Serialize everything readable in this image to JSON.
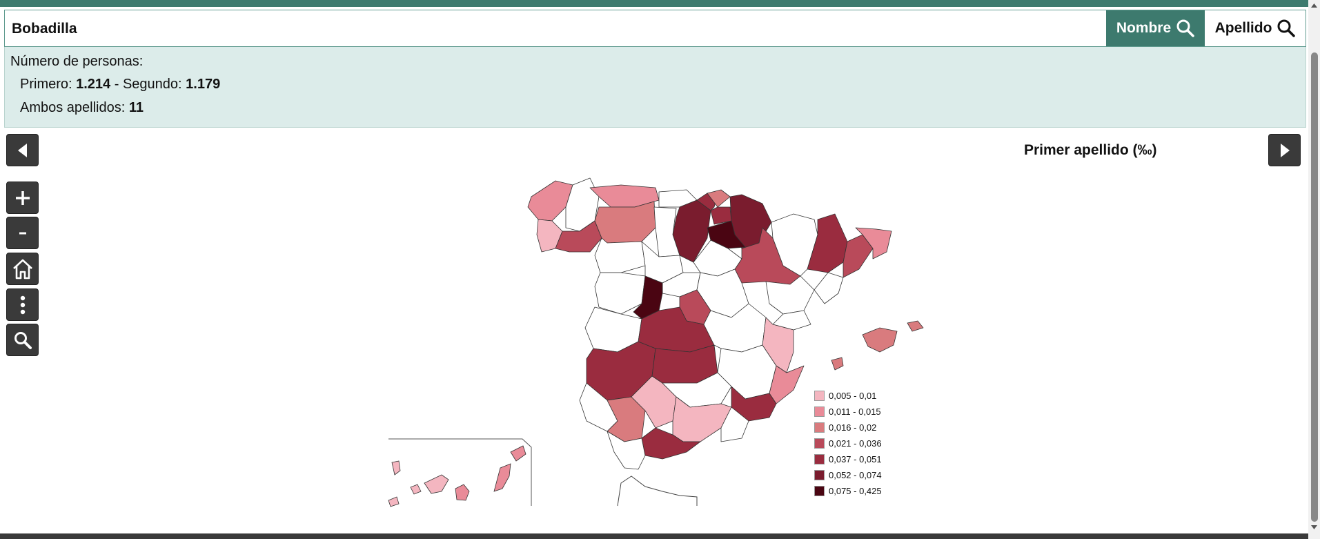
{
  "search": {
    "value": "Bobadilla",
    "nombre_label": "Nombre",
    "apellido_label": "Apellido"
  },
  "info": {
    "title": "Número de personas:",
    "primero_label": "Primero: ",
    "primero_value": "1.214",
    "segundo_label": " - Segundo: ",
    "segundo_value": "1.179",
    "ambos_label": "Ambos apellidos: ",
    "ambos_value": "11"
  },
  "map": {
    "title": "Primer apellido (‰)"
  },
  "legend": [
    {
      "label": "0,005 - 0,01",
      "color": "#f4b6c0"
    },
    {
      "label": "0,011 - 0,015",
      "color": "#e98b98"
    },
    {
      "label": "0,016 - 0,02",
      "color": "#d97b7e"
    },
    {
      "label": "0,021 - 0,036",
      "color": "#b94a5a"
    },
    {
      "label": "0,037 - 0,051",
      "color": "#9a2c3f"
    },
    {
      "label": "0,052 - 0,074",
      "color": "#7a1c2e"
    },
    {
      "label": "0,075 - 0,425",
      "color": "#4a0512"
    }
  ],
  "colors": {
    "accent": "#3d7a6e",
    "info_bg": "#dcecea",
    "control_bg": "#3a3a3a"
  }
}
